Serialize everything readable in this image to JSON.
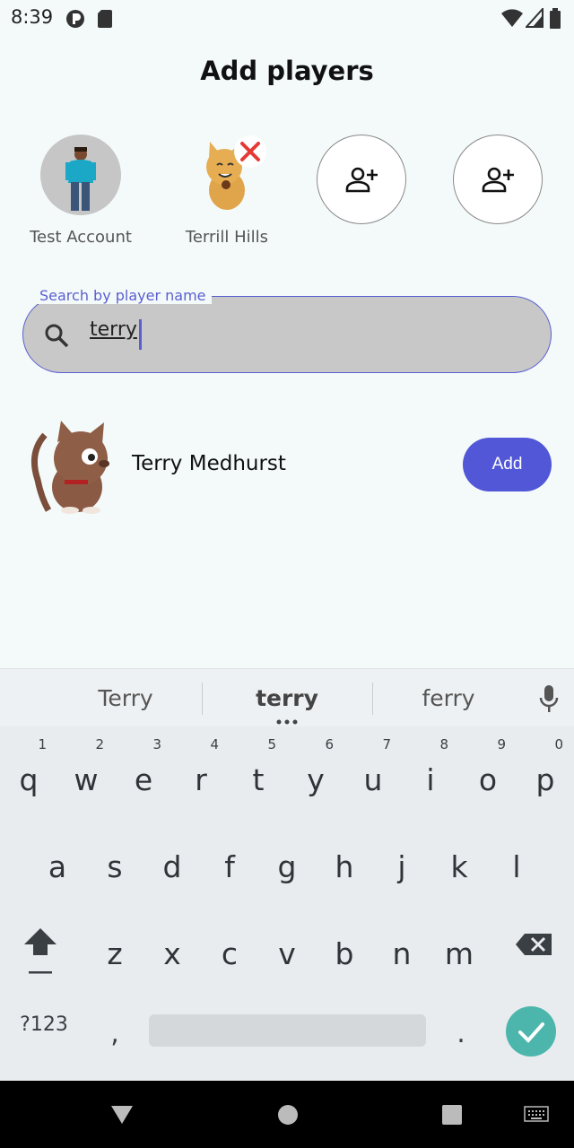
{
  "status_bar": {
    "time": "8:39"
  },
  "header": {
    "title": "Add players"
  },
  "selected_players": [
    {
      "name": "Test Account"
    },
    {
      "name": "Terrill Hills"
    }
  ],
  "search": {
    "label": "Search by player name",
    "value": "terry"
  },
  "results": [
    {
      "name": "Terry Medhurst",
      "action": "Add"
    }
  ],
  "keyboard": {
    "suggestions": [
      "Terry",
      "terry",
      "ferry"
    ],
    "row1": [
      {
        "ch": "q",
        "hint": "1"
      },
      {
        "ch": "w",
        "hint": "2"
      },
      {
        "ch": "e",
        "hint": "3"
      },
      {
        "ch": "r",
        "hint": "4"
      },
      {
        "ch": "t",
        "hint": "5"
      },
      {
        "ch": "y",
        "hint": "6"
      },
      {
        "ch": "u",
        "hint": "7"
      },
      {
        "ch": "i",
        "hint": "8"
      },
      {
        "ch": "o",
        "hint": "9"
      },
      {
        "ch": "p",
        "hint": "0"
      }
    ],
    "row2": [
      "a",
      "s",
      "d",
      "f",
      "g",
      "h",
      "j",
      "k",
      "l"
    ],
    "row3": [
      "z",
      "x",
      "c",
      "v",
      "b",
      "n",
      "m"
    ],
    "symbols_label": "?123",
    "comma": ",",
    "period": "."
  },
  "colors": {
    "accent": "#5157d6",
    "enter_key": "#4db6ac",
    "background": "#f4fafa"
  }
}
